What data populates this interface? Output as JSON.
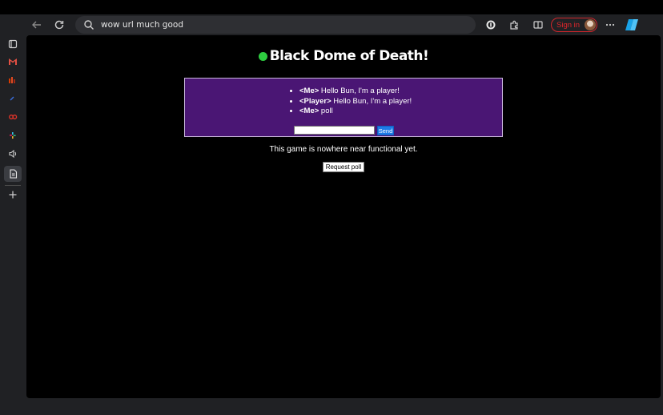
{
  "browser": {
    "address_text": "wow url much good",
    "sign_in_label": "Sign in"
  },
  "page": {
    "title": "Black Dome of Death!",
    "status_text": "This game is nowhere near functional yet.",
    "request_poll_label": "Request poll"
  },
  "chat": {
    "messages": [
      {
        "sender": "<Me>",
        "text": " Hello Bun, I'm a player!"
      },
      {
        "sender": "<Player>",
        "text": " Hello Bun, I'm a player!"
      },
      {
        "sender": "<Me>",
        "text": " poll"
      }
    ],
    "input_value": "",
    "send_label": "Send"
  },
  "colors": {
    "chat_bg": "#4a1674",
    "title_dot": "#2ecc40",
    "send_button": "#1e7be6",
    "sign_in": "#e0262b"
  }
}
